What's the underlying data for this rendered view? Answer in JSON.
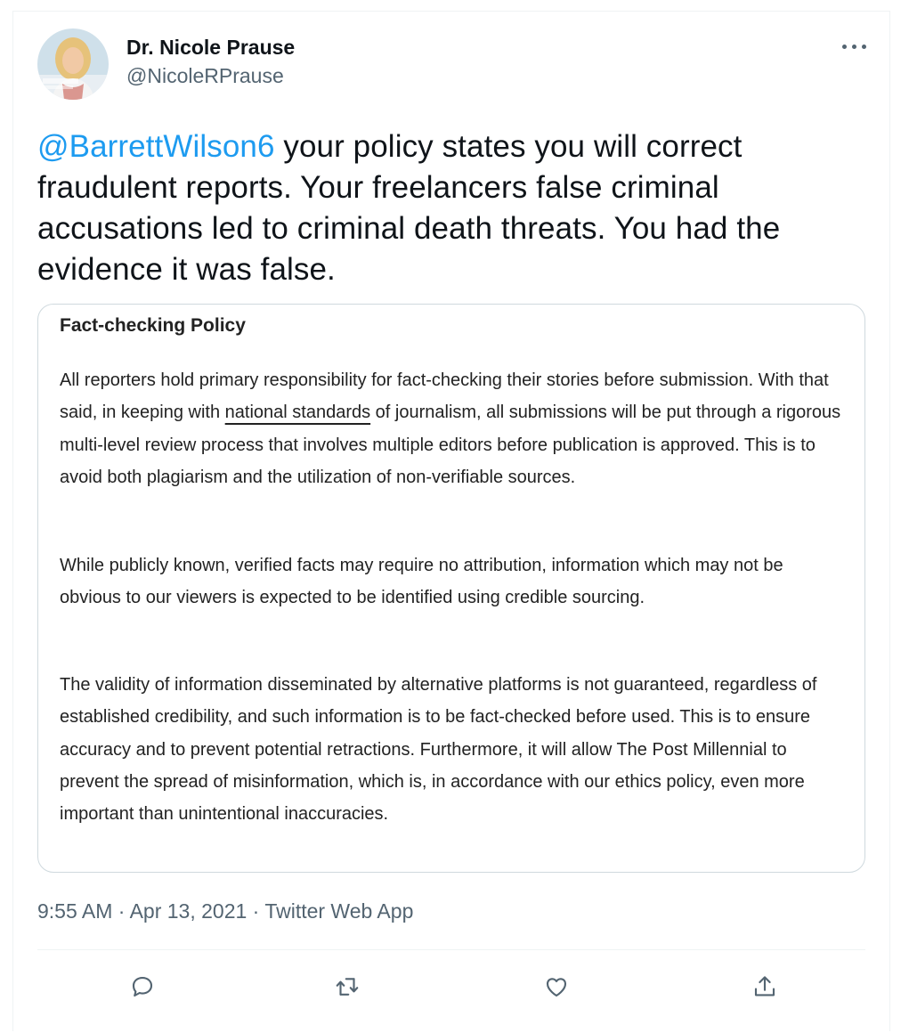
{
  "author": {
    "name": "Dr. Nicole Prause",
    "handle": "@NicoleRPrause",
    "avatar_caption": "Nicole Prause"
  },
  "tweet": {
    "mention": "@BarrettWilson6",
    "text": " your policy states you will correct fraudulent reports. Your freelancers false criminal accusations led to criminal death threats. You had the evidence it was false."
  },
  "card": {
    "title": "Fact-checking Policy",
    "p1_before": "All reporters hold primary responsibility for fact-checking their stories before submission. With that said, in keeping with ",
    "p1_link": "national standards",
    "p1_after": " of journalism, all submissions will be put through a rigorous multi-level review process that involves multiple editors before publication is approved. This is to avoid both plagiarism and the utilization of non-verifiable sources.",
    "p2": "While publicly known, verified facts may require no attribution, information which may not be obvious to our viewers is expected to be identified using credible sourcing.",
    "p3": "The validity of information disseminated by alternative platforms is not guaranteed, regardless of established credibility, and such information is to be fact-checked before used. This is to ensure accuracy and to prevent potential retractions. Furthermore, it will allow The Post Millennial to prevent the spread of misinformation, which is, in accordance with our ethics policy, even more important than unintentional inaccuracies."
  },
  "meta": {
    "time": "9:55 AM",
    "sep1": " · ",
    "date": "Apr 13, 2021",
    "sep2": " · ",
    "source": "Twitter Web App"
  },
  "actions": {
    "reply_icon": "reply-icon",
    "retweet_icon": "retweet-icon",
    "like_icon": "heart-icon",
    "share_icon": "share-icon"
  },
  "colors": {
    "accent": "#1d9bf0",
    "text": "#0f1419",
    "secondary": "#536471",
    "border": "#cfd9de"
  }
}
